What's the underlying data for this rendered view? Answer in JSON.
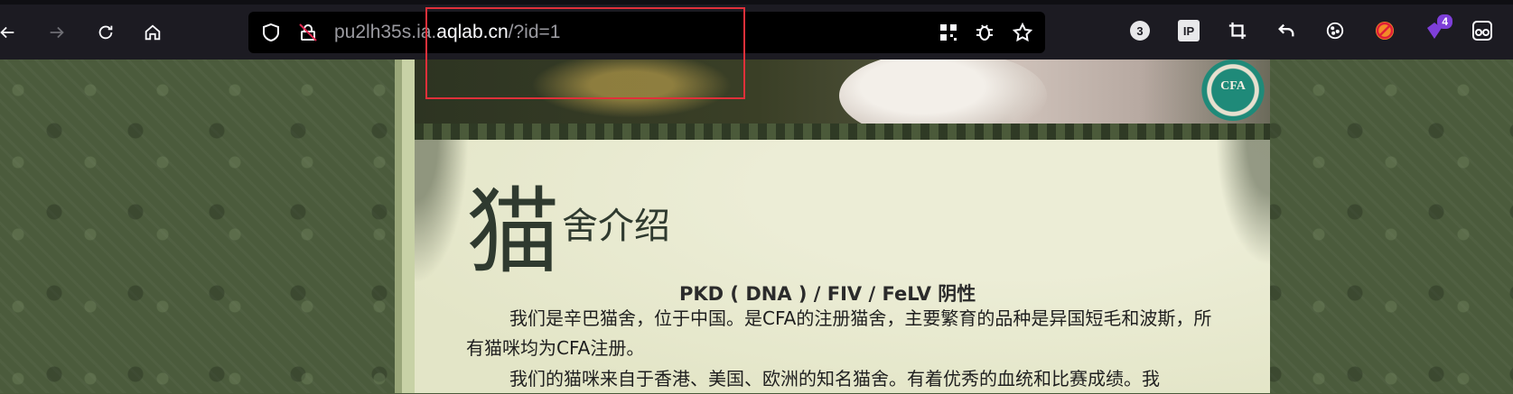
{
  "browser": {
    "url_prefix": "pu2lh35s.ia.",
    "url_domain": "aqlab.cn",
    "url_path": "/?id=1",
    "nav_icons": [
      "back-icon",
      "forward-icon",
      "reload-icon",
      "home-icon"
    ],
    "extensions": {
      "badge_count": "3",
      "ip_label": "IP",
      "ext_notification": "4"
    }
  },
  "page": {
    "title_big_char": "猫",
    "title_rest": "舍介绍",
    "logo_text": "CFA",
    "subheading": "PKD ( DNA ) / FIV / FeLV 阴性",
    "paragraphs": [
      "我们是辛巴猫舍，位于中国。是CFA的注册猫舍，主要繁育的品种是异国短毛和波斯，所有猫咪均为CFA注册。",
      "我们的猫咪来自于香港、美国、欧洲的知名猫舍。有着优秀的血统和比赛成绩。我"
    ]
  },
  "colors": {
    "toolbar_bg": "#1c1b22",
    "highlight_border": "#e0303a",
    "content_bg": "#e6e8cd",
    "title_color": "#2f3a2f"
  }
}
